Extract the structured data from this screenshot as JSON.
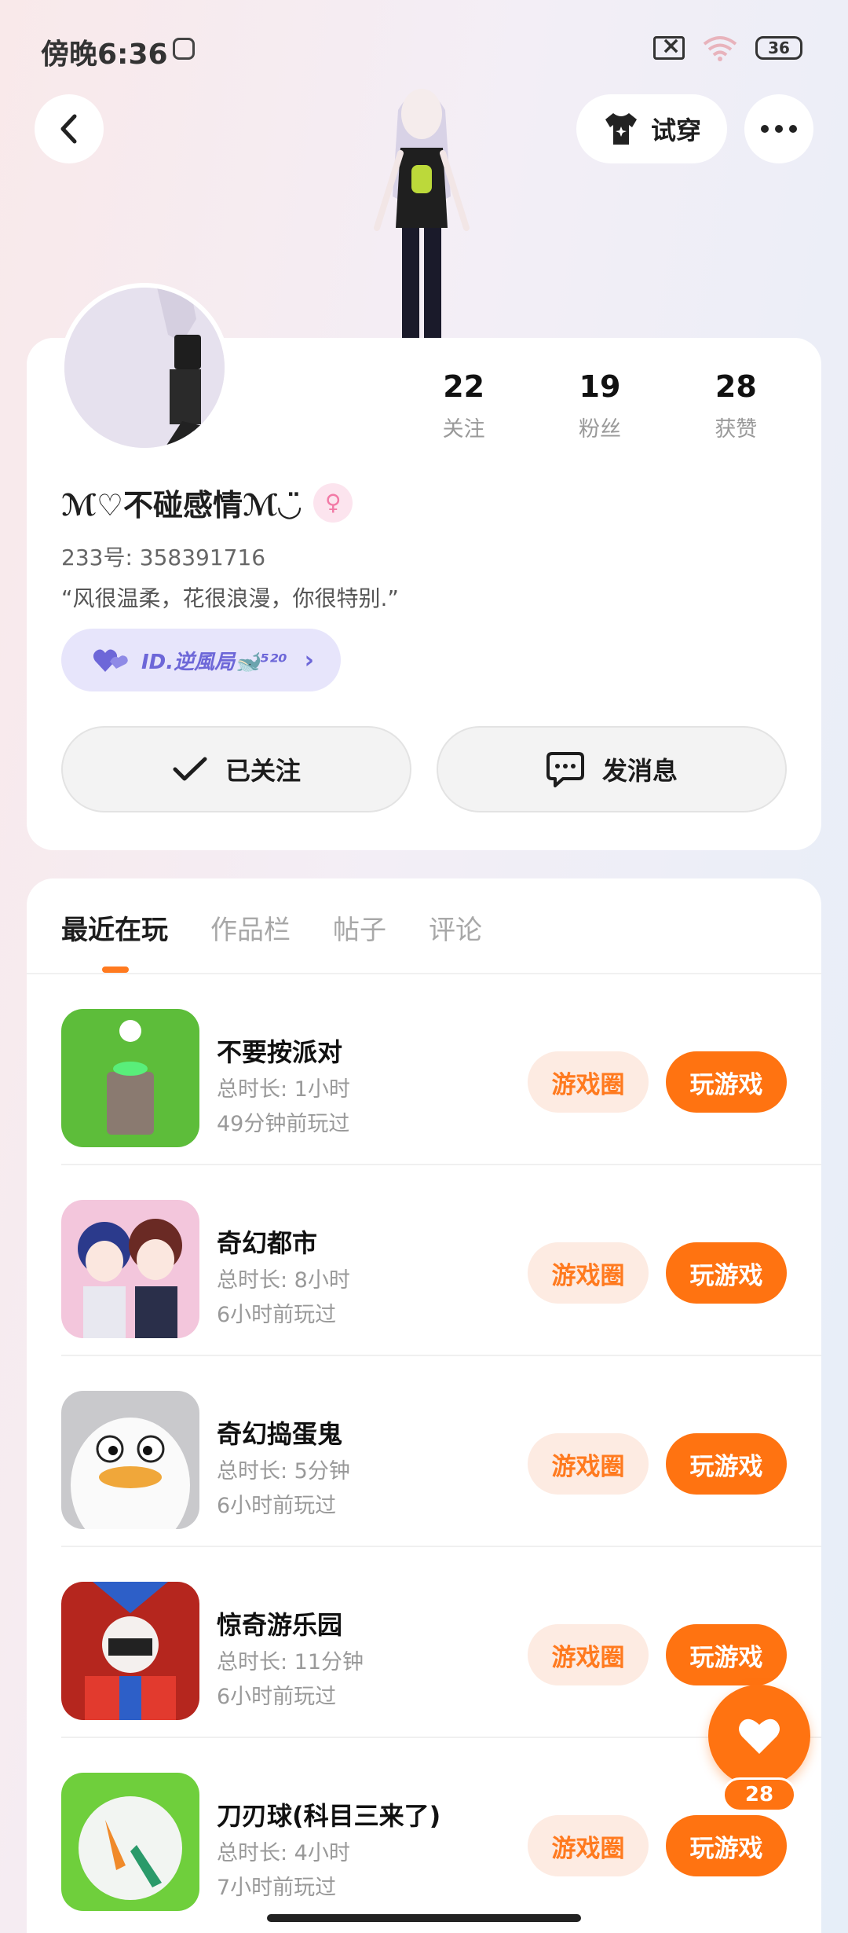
{
  "status_bar": {
    "time": "傍晚6:36",
    "battery": "36"
  },
  "header": {
    "tryon_label": "试穿"
  },
  "profile": {
    "stats": [
      {
        "value": "22",
        "label": "关注"
      },
      {
        "value": "19",
        "label": "粉丝"
      },
      {
        "value": "28",
        "label": "获赞"
      }
    ],
    "username": "ℳ♡不碰感情ℳ◡̈",
    "user_id": "233号: 358391716",
    "bio": "“风很温柔，花很浪漫，你很特别.”",
    "guild": "ID.逆風局🐋⁵²⁰",
    "follow_label": "已关注",
    "message_label": "发消息"
  },
  "tabs": [
    {
      "label": "最近在玩",
      "active": true
    },
    {
      "label": "作品栏",
      "active": false
    },
    {
      "label": "帖子",
      "active": false
    },
    {
      "label": "评论",
      "active": false
    }
  ],
  "games": [
    {
      "name": "不要按派对",
      "duration": "总时长: 1小时",
      "last_played": "49分钟前玩过",
      "circle_label": "游戏圈",
      "play_label": "玩游戏"
    },
    {
      "name": "奇幻都市",
      "duration": "总时长: 8小时",
      "last_played": "6小时前玩过",
      "circle_label": "游戏圈",
      "play_label": "玩游戏"
    },
    {
      "name": "奇幻捣蛋鬼",
      "duration": "总时长: 5分钟",
      "last_played": "6小时前玩过",
      "circle_label": "游戏圈",
      "play_label": "玩游戏"
    },
    {
      "name": "惊奇游乐园",
      "duration": "总时长: 11分钟",
      "last_played": "6小时前玩过",
      "circle_label": "游戏圈",
      "play_label": "玩游戏"
    },
    {
      "name": "刀刃球(科目三来了)",
      "duration": "总时长: 4小时",
      "last_played": "7小时前玩过",
      "circle_label": "游戏圈",
      "play_label": "玩游戏"
    }
  ],
  "like": {
    "count": "28"
  },
  "colors": {
    "accent": "#ff7311",
    "accent_soft": "#fdebe2",
    "guild": "#6d67d8"
  }
}
